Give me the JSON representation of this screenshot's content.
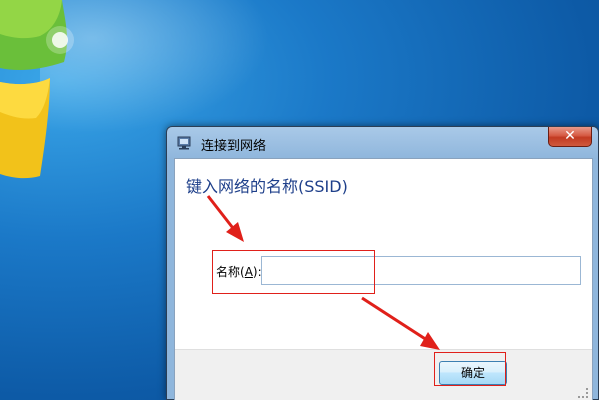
{
  "dialog": {
    "title": "连接到网络",
    "heading": "键入网络的名称(SSID)",
    "name_label_prefix": "名称(",
    "name_label_accel": "A",
    "name_label_suffix": "):",
    "name_value": "",
    "ok_label": "确定",
    "close_label": "✕"
  },
  "colors": {
    "heading": "#1e3f8a",
    "annotation": "#e0201a",
    "close_button": "#c23a22"
  }
}
